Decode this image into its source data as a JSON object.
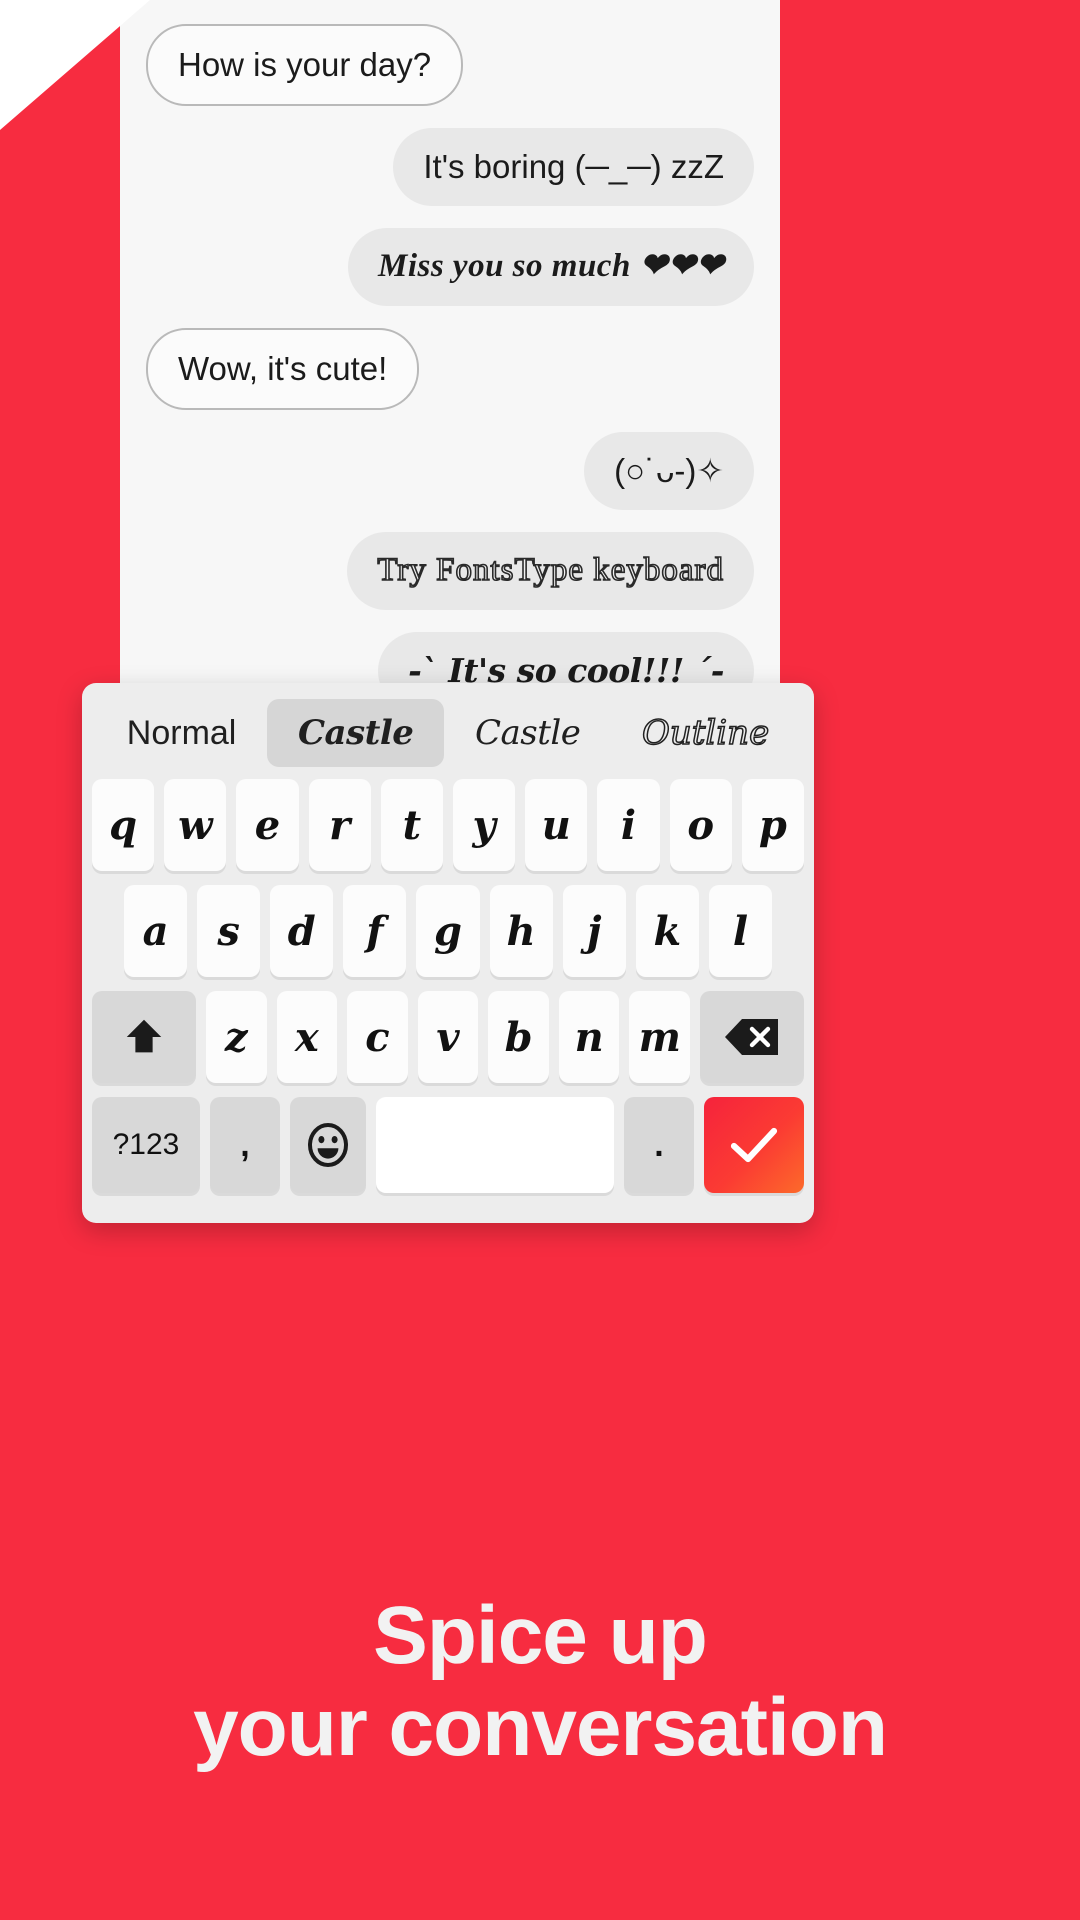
{
  "theme": {
    "background": "#F72C40",
    "chat_panel_bg": "#F7F7F7",
    "outgoing_bubble": "#E8E8E8",
    "incoming_bubble": "#FBFBFB",
    "keyboard_bg": "#EDEDED",
    "key_bg": "#FCFCFC",
    "fn_key_bg": "#D8D8D8",
    "enter_key_gradient_start": "#F5233C",
    "enter_key_gradient_end": "#FC6A2A",
    "headline_color": "#F2F2F2"
  },
  "chat": {
    "messages": [
      {
        "text": "How is your day?",
        "side": "left",
        "style": "normal"
      },
      {
        "text": "It's boring (─_─) zzZ",
        "side": "right",
        "style": "normal"
      },
      {
        "text": "Miss you so much ❤❤❤",
        "side": "right",
        "style": "serif-italic"
      },
      {
        "text": "Wow, it's cute!",
        "side": "left",
        "style": "normal"
      },
      {
        "text": "(○˙ᴗ-)✧",
        "side": "right",
        "style": "normal"
      },
      {
        "text": "Try FontsType keyboard",
        "side": "right",
        "style": "outline"
      },
      {
        "text": "-` It's so cool!!! ´-",
        "side": "right",
        "style": "gothic"
      }
    ]
  },
  "keyboard": {
    "font_tabs": [
      {
        "label": "Normal",
        "style": "normal",
        "selected": false
      },
      {
        "label": "Castle",
        "style": "castle-bold",
        "selected": true
      },
      {
        "label": "Castle",
        "style": "castle-light",
        "selected": false
      },
      {
        "label": "Outline",
        "style": "outline",
        "selected": false
      }
    ],
    "row1": [
      "q",
      "w",
      "e",
      "r",
      "t",
      "y",
      "u",
      "i",
      "o",
      "p"
    ],
    "row2": [
      "a",
      "s",
      "d",
      "f",
      "g",
      "h",
      "j",
      "k",
      "l"
    ],
    "row3_letters": [
      "z",
      "x",
      "c",
      "v",
      "b",
      "n",
      "m"
    ],
    "shift_icon": "shift-arrow-icon",
    "backspace_icon": "backspace-icon",
    "symbols_key": "?123",
    "comma_key": ",",
    "emoji_icon": "emoji-smiley-icon",
    "space_key": "",
    "period_key": ".",
    "enter_icon": "checkmark-icon"
  },
  "headline": {
    "line1": "Spice up",
    "line2": "your conversation"
  }
}
